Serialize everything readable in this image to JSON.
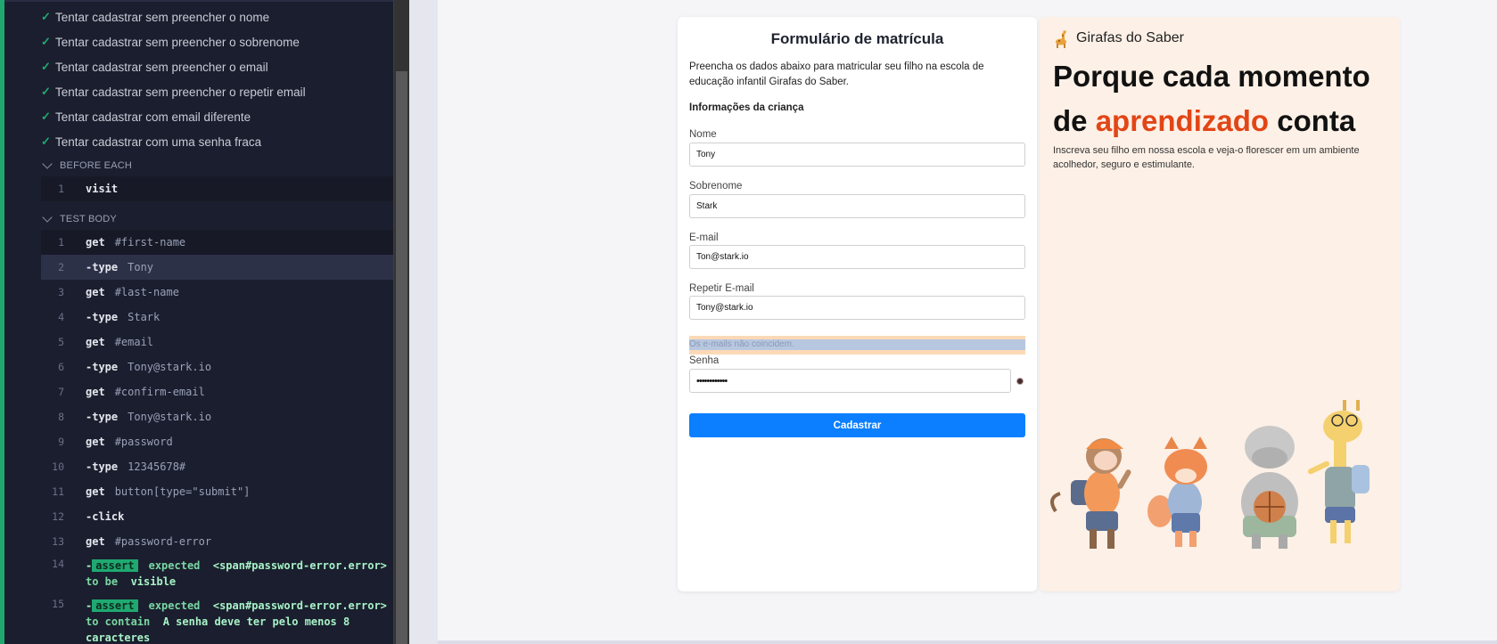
{
  "reporter": {
    "tests": [
      "Tentar cadastrar sem preencher o nome",
      "Tentar cadastrar sem preencher o sobrenome",
      "Tentar cadastrar sem preencher o email",
      "Tentar cadastrar sem preencher o repetir email",
      "Tentar cadastrar com email diferente",
      "Tentar cadastrar com uma senha fraca"
    ],
    "before_each": {
      "label": "BEFORE EACH",
      "commands": [
        {
          "num": "1",
          "name": "visit",
          "msg": ""
        }
      ]
    },
    "test_body": {
      "label": "TEST BODY",
      "commands": [
        {
          "num": "1",
          "name": "get",
          "msg": "#first-name"
        },
        {
          "num": "2",
          "name": "-type",
          "msg": "Tony"
        },
        {
          "num": "3",
          "name": "get",
          "msg": "#last-name"
        },
        {
          "num": "4",
          "name": "-type",
          "msg": "Stark"
        },
        {
          "num": "5",
          "name": "get",
          "msg": "#email"
        },
        {
          "num": "6",
          "name": "-type",
          "msg": "Tony@stark.io"
        },
        {
          "num": "7",
          "name": "get",
          "msg": "#confirm-email"
        },
        {
          "num": "8",
          "name": "-type",
          "msg": "Tony@stark.io"
        },
        {
          "num": "9",
          "name": "get",
          "msg": "#password"
        },
        {
          "num": "10",
          "name": "-type",
          "msg": "12345678#"
        },
        {
          "num": "11",
          "name": "get",
          "msg": "button[type=\"submit\"]"
        },
        {
          "num": "12",
          "name": "-click",
          "msg": ""
        },
        {
          "num": "13",
          "name": "get",
          "msg": "#password-error"
        }
      ],
      "assertions": [
        {
          "num": "14",
          "prefix": "-",
          "badge": "assert",
          "word": "expected",
          "subject": "<span#password-error.error>",
          "line2_a": "to be",
          "line2_b": "visible"
        },
        {
          "num": "15",
          "prefix": "-",
          "badge": "assert",
          "word": "expected",
          "subject": "<span#password-error.error>",
          "line2_a": "to contain",
          "line2_b": "A senha deve ter pelo menos 8",
          "line3": "caracteres"
        }
      ]
    }
  },
  "form": {
    "title": "Formulário de matrícula",
    "intro": "Preencha os dados abaixo para matricular seu filho na escola de educação infantil Girafas do Saber.",
    "section": "Informações da criança",
    "fields": {
      "first_name": {
        "label": "Nome",
        "value": "Tony"
      },
      "last_name": {
        "label": "Sobrenome",
        "value": "Stark"
      },
      "email": {
        "label": "E-mail",
        "value": "Ton@stark.io"
      },
      "confirm_email": {
        "label": "Repetir E-mail",
        "value": "Tony@stark.io"
      },
      "password": {
        "label": "Senha",
        "value": "••••••••••••"
      }
    },
    "email_error": "Os e-mails não coincidem.",
    "submit": "Cadastrar"
  },
  "promo": {
    "brand": "Girafas do Saber",
    "headline_1": "Porque cada momento de",
    "headline_accent": "aprendizado",
    "headline_2": "conta",
    "subtitle": "Inscreva seu filho em nossa escola e veja-o florescer em um ambiente acolhedor, seguro e estimulante.",
    "accent_color": "#e24516",
    "button_color": "#0b7fff",
    "pass_color": "#1fa971"
  }
}
